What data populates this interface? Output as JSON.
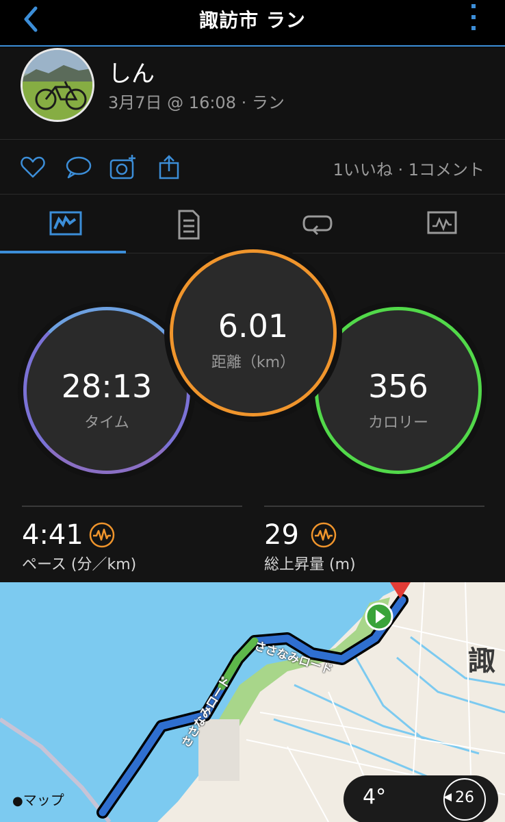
{
  "header": {
    "title": "諏訪市 ラン",
    "back_icon": "chevron-left-icon",
    "more_icon": "more-vertical-icon",
    "accent": "#3c8ed8"
  },
  "profile": {
    "name": "しん",
    "meta": "3月7日 @ 16:08 · ラン"
  },
  "actions": {
    "icons": [
      "heart-icon",
      "comment-icon",
      "camera-add-icon",
      "share-icon"
    ],
    "counts": "1いいね · 1コメント"
  },
  "tabs": [
    {
      "icon": "overview-icon",
      "active": true
    },
    {
      "icon": "details-icon",
      "active": false
    },
    {
      "icon": "laps-icon",
      "active": false
    },
    {
      "icon": "charts-icon",
      "active": false
    }
  ],
  "stats": {
    "time": {
      "value": "28:13",
      "label": "タイム",
      "color": "#7b72d6"
    },
    "distance": {
      "value": "6.01",
      "label": "距離（km）",
      "color": "#f0952c"
    },
    "calories": {
      "value": "356",
      "label": "カロリー",
      "color": "#52d94a"
    }
  },
  "metrics": {
    "pace": {
      "value": "4:41",
      "label": "ペース (分／km)"
    },
    "elevation": {
      "value": "29",
      "label": "総上昇量 (m)"
    }
  },
  "map": {
    "road_label_1": "ささなみロード",
    "road_label_2": "ささなみロード",
    "city": "諏",
    "attribution": "マップ",
    "temperature": "4°",
    "wind": "26"
  }
}
